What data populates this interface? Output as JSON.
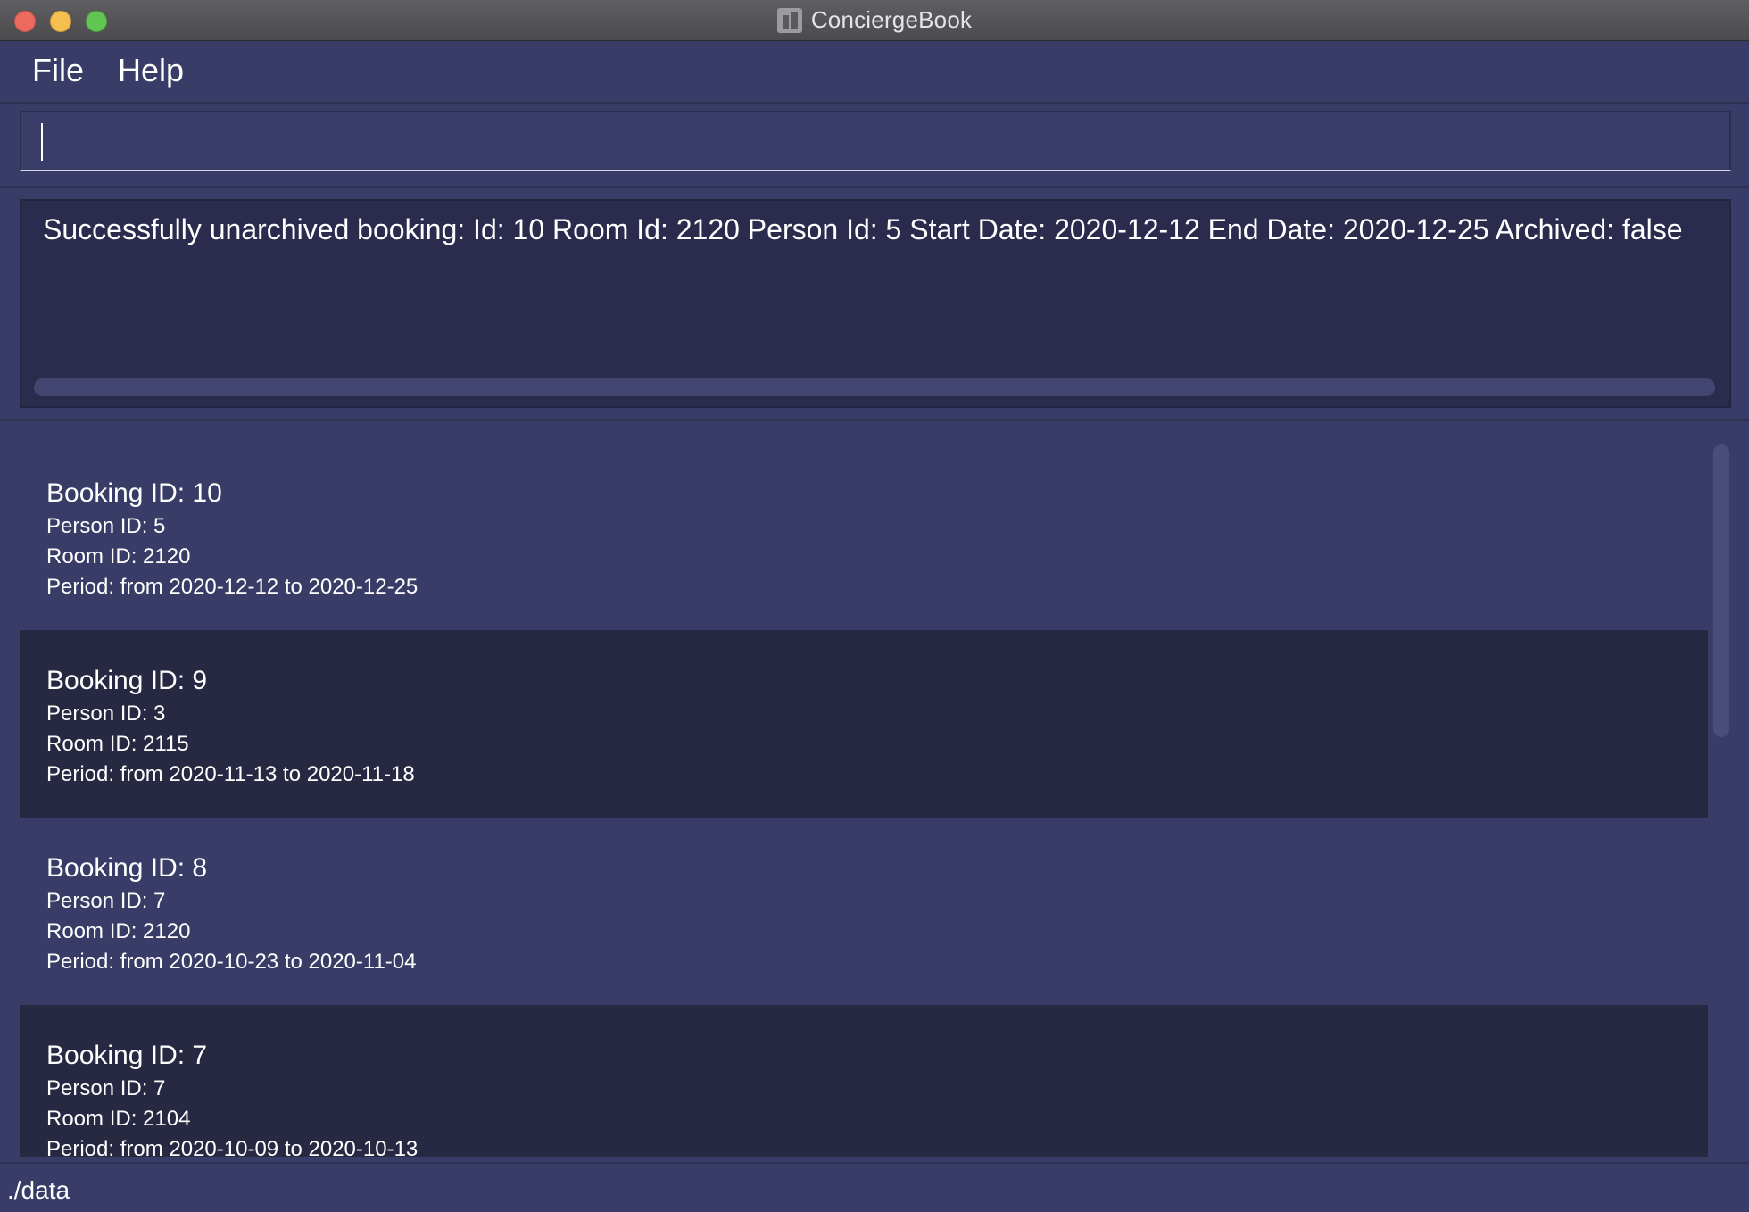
{
  "window": {
    "title": "ConciergeBook",
    "app_icon": "building-icon"
  },
  "menu": {
    "items": [
      {
        "label": "File"
      },
      {
        "label": "Help"
      }
    ]
  },
  "command_box": {
    "value": "",
    "placeholder": ""
  },
  "result_display": {
    "text": "Successfully unarchived booking: Id: 10 Room Id: 2120 Person Id: 5 Start Date: 2020-12-12 End Date: 2020-12-25 Archived: false"
  },
  "bookings": [
    {
      "title": "Booking ID: 10",
      "person": "Person ID: 5",
      "room": "Room ID: 2120",
      "period": "Period: from 2020-12-12 to 2020-12-25"
    },
    {
      "title": "Booking ID: 9",
      "person": "Person ID: 3",
      "room": "Room ID: 2115",
      "period": "Period: from 2020-11-13 to 2020-11-18"
    },
    {
      "title": "Booking ID: 8",
      "person": "Person ID: 7",
      "room": "Room ID: 2120",
      "period": "Period: from 2020-10-23 to 2020-11-04"
    },
    {
      "title": "Booking ID: 7",
      "person": "Person ID: 7",
      "room": "Room ID: 2104",
      "period": "Period: from 2020-10-09 to 2020-10-13"
    }
  ],
  "status_bar": {
    "path": "./data"
  },
  "colors": {
    "background": "#393c66",
    "card_dark": "#272942",
    "result_bg": "#2a2b4d",
    "text": "#ffffff"
  }
}
